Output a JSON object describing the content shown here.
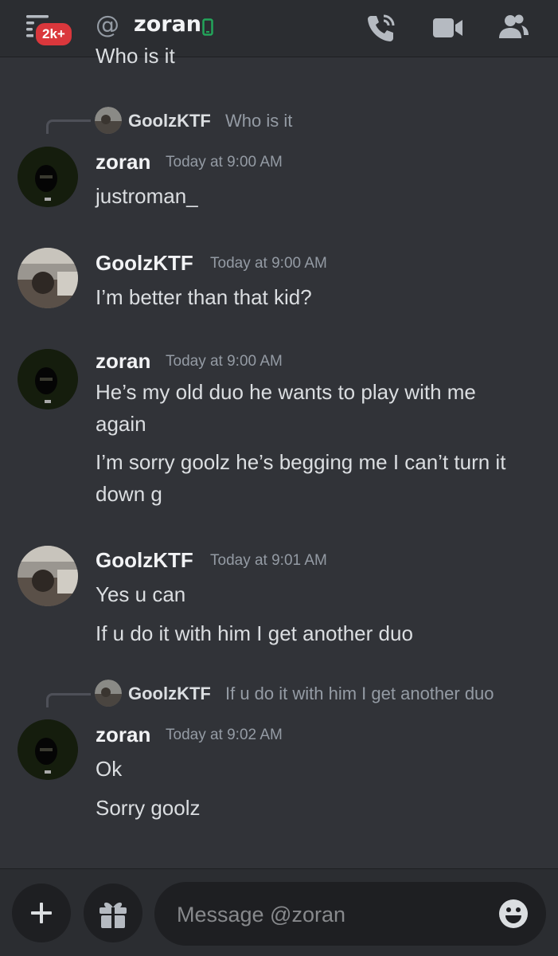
{
  "header": {
    "badge": "2k+",
    "at_symbol": "@",
    "dm_name": "zoran",
    "icons": [
      "menu-icon",
      "at-icon",
      "mobile-icon",
      "voice-call-icon",
      "video-call-icon",
      "members-icon"
    ]
  },
  "messages": {
    "partial_top": "Who is it",
    "reply1": {
      "author": "GoolzKTF",
      "snippet": "Who is it"
    },
    "m1": {
      "author": "zoran",
      "time": "Today at 9:00 AM",
      "lines": [
        "justroman_"
      ]
    },
    "m2": {
      "author": "GoolzKTF",
      "time": "Today at 9:00 AM",
      "lines": [
        "I’m better than that kid?"
      ]
    },
    "m3": {
      "author": "zoran",
      "time": "Today at 9:00 AM",
      "lines": [
        "He’s my old duo he wants to play with me again",
        "I’m sorry goolz he’s begging me I can’t turn it down g"
      ]
    },
    "m4": {
      "author": "GoolzKTF",
      "time": "Today at 9:01 AM",
      "lines": [
        "Yes u can",
        "If u do it with him I get another duo"
      ]
    },
    "reply2": {
      "author": "GoolzKTF",
      "snippet": "If u do it with him I get another duo"
    },
    "m5": {
      "author": "zoran",
      "time": "Today at 9:02 AM",
      "lines": [
        "Ok",
        "Sorry goolz"
      ]
    }
  },
  "composer": {
    "placeholder": "Message @zoran",
    "icons": [
      "plus-icon",
      "gift-icon",
      "emoji-icon"
    ]
  },
  "colors": {
    "background": "#313338",
    "header": "#2b2d31",
    "badge": "#da373c",
    "online_mobile": "#23a55a",
    "muted_text": "#949ba4"
  }
}
